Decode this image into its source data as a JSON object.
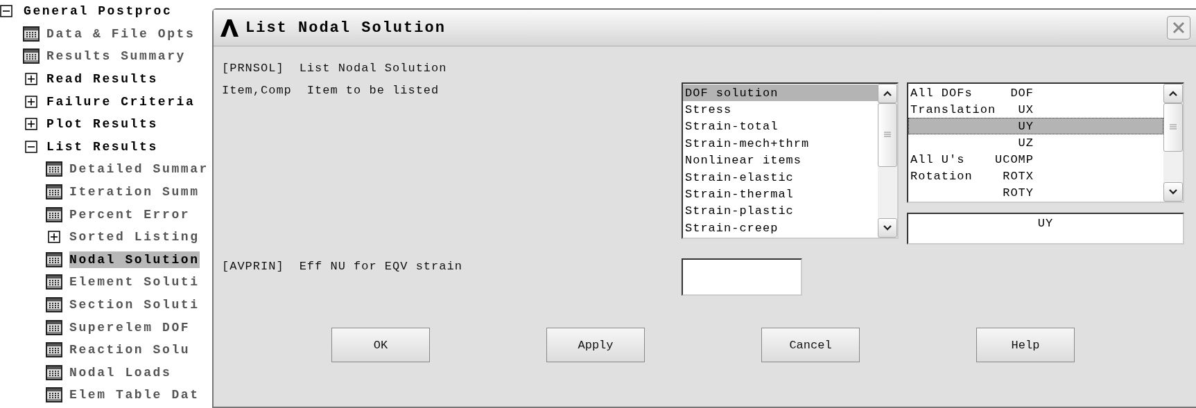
{
  "tree": {
    "label": "General Postproc",
    "expanded": true,
    "children": [
      {
        "label": "Data & File Opts",
        "kind": "command",
        "dimmed": true,
        "selected": false
      },
      {
        "label": "Results Summary",
        "kind": "command",
        "dimmed": true,
        "selected": false
      },
      {
        "label": "Read Results",
        "kind": "folder",
        "expanded": false,
        "dimmed": false,
        "selected": false
      },
      {
        "label": "Failure Criteria",
        "kind": "folder",
        "expanded": false,
        "dimmed": false,
        "selected": false
      },
      {
        "label": "Plot Results",
        "kind": "folder",
        "expanded": false,
        "dimmed": false,
        "selected": false
      },
      {
        "label": "List Results",
        "kind": "folder",
        "expanded": true,
        "dimmed": false,
        "selected": false,
        "children": [
          {
            "label": "Detailed Summar",
            "kind": "command",
            "dimmed": true,
            "selected": false
          },
          {
            "label": "Iteration Summ",
            "kind": "command",
            "dimmed": true,
            "selected": false
          },
          {
            "label": "Percent Error",
            "kind": "command",
            "dimmed": true,
            "selected": false
          },
          {
            "label": "Sorted Listing",
            "kind": "folder",
            "expanded": false,
            "dimmed": true,
            "selected": false
          },
          {
            "label": "Nodal Solution",
            "kind": "command",
            "dimmed": false,
            "selected": true
          },
          {
            "label": "Element Soluti",
            "kind": "command",
            "dimmed": true,
            "selected": false
          },
          {
            "label": "Section Soluti",
            "kind": "command",
            "dimmed": true,
            "selected": false
          },
          {
            "label": "Superelem DOF",
            "kind": "command",
            "dimmed": true,
            "selected": false
          },
          {
            "label": "Reaction Solu",
            "kind": "command",
            "dimmed": true,
            "selected": false
          },
          {
            "label": "Nodal Loads",
            "kind": "command",
            "dimmed": true,
            "selected": false
          },
          {
            "label": "Elem Table Dat",
            "kind": "command",
            "dimmed": true,
            "selected": false
          }
        ]
      }
    ]
  },
  "dialog": {
    "title": "List Nodal Solution",
    "command": {
      "code": "[PRNSOL]",
      "text": "List Nodal Solution"
    },
    "item_comp": {
      "code": "Item,Comp",
      "text": "Item to be listed",
      "items": [
        {
          "label": "DOF solution",
          "selected": true
        },
        {
          "label": "Stress",
          "selected": false
        },
        {
          "label": "Strain-total",
          "selected": false
        },
        {
          "label": "Strain-mech+thrm",
          "selected": false
        },
        {
          "label": "Nonlinear items",
          "selected": false
        },
        {
          "label": "Strain-elastic",
          "selected": false
        },
        {
          "label": "Strain-thermal",
          "selected": false
        },
        {
          "label": "Strain-plastic",
          "selected": false
        },
        {
          "label": "Strain-creep",
          "selected": false
        }
      ],
      "components": [
        {
          "label": "All DOFs",
          "code": "DOF",
          "selected": false
        },
        {
          "label": "Translation",
          "code": "UX",
          "selected": false
        },
        {
          "code": "UY",
          "selected": true
        },
        {
          "code": "UZ",
          "selected": false
        },
        {
          "label": "All U's",
          "code": "UCOMP",
          "selected": false
        },
        {
          "label": "Rotation",
          "code": "ROTX",
          "selected": false
        },
        {
          "code": "ROTY",
          "selected": false
        }
      ],
      "value": "UY"
    },
    "avprin": {
      "code": "[AVPRIN]",
      "text": "Eff NU for EQV strain"
    },
    "buttons": [
      "OK",
      "Apply",
      "Cancel",
      "Help"
    ]
  }
}
